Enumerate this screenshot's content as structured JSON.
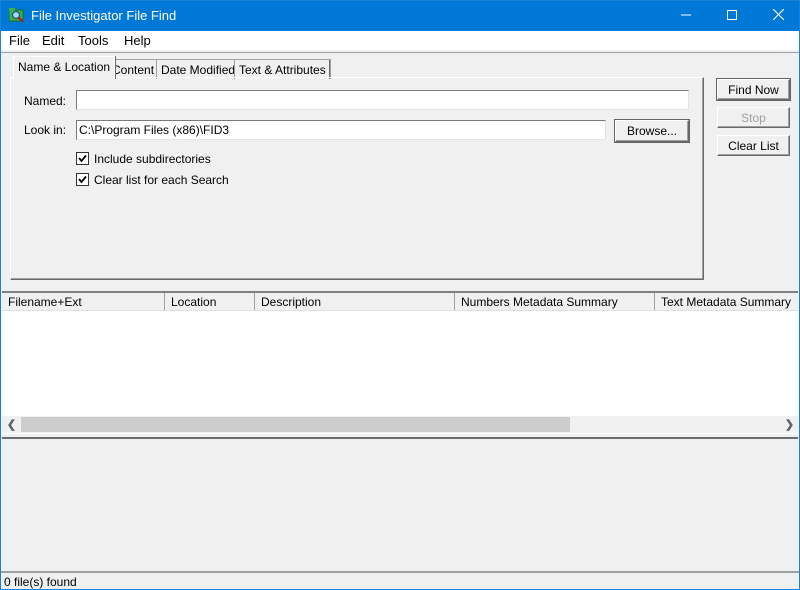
{
  "window": {
    "title": "File Investigator File Find",
    "controls": {
      "minimize": "minimize",
      "maximize": "maximize",
      "close": "close"
    }
  },
  "menu": {
    "items": [
      "File",
      "Edit",
      "Tools",
      "Help"
    ]
  },
  "tabs": [
    {
      "label": "Name & Location",
      "active": true
    },
    {
      "label": "Content",
      "active": false
    },
    {
      "label": "Date Modified",
      "active": false
    },
    {
      "label": "Text & Attributes",
      "active": false
    }
  ],
  "form": {
    "named_label": "Named:",
    "named_value": "",
    "lookin_label": "Look in:",
    "lookin_value": "C:\\Program Files (x86)\\FID3",
    "browse_label": "Browse...",
    "include_subdirs_label": "Include subdirectories",
    "include_subdirs_checked": true,
    "clear_list_label": "Clear list for each Search",
    "clear_list_checked": true
  },
  "actions": {
    "find_now": "Find Now",
    "stop": "Stop",
    "stop_enabled": false,
    "clear_list": "Clear List"
  },
  "results": {
    "columns": [
      "Filename+Ext",
      "Location",
      "Description",
      "Numbers Metadata Summary",
      "Text Metadata Summary"
    ],
    "rows": [],
    "scroll_fraction_visible": 0.7
  },
  "status": {
    "text": "0 file(s) found"
  }
}
